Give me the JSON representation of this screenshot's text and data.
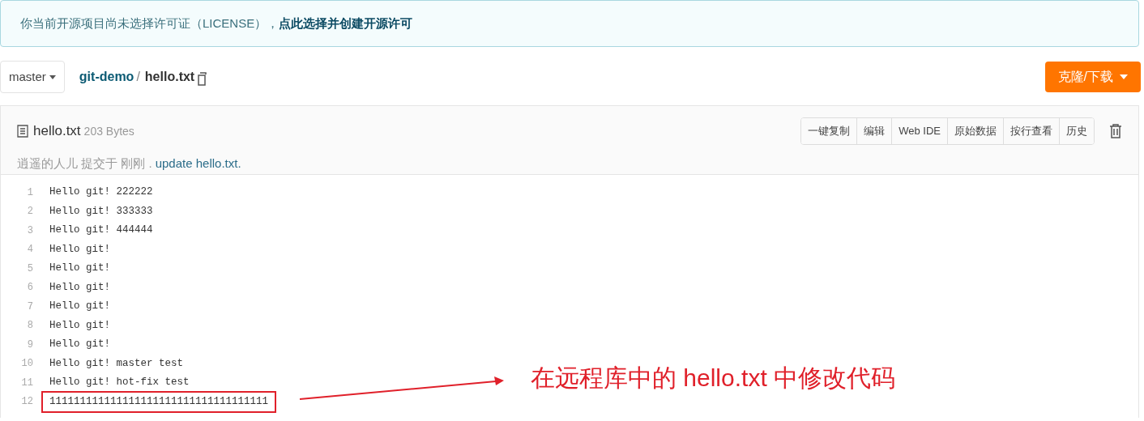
{
  "notice": {
    "text": "你当前开源项目尚未选择许可证（LICENSE），",
    "link": "点此选择并创建开源许可"
  },
  "branch": "master",
  "breadcrumb": {
    "repo": "git-demo",
    "separator": "/",
    "file": "hello.txt"
  },
  "clone_button": "克隆/下载",
  "file": {
    "name": "hello.txt",
    "size": "203 Bytes",
    "commit_author": "逍遥的人儿 提交于 刚刚 .",
    "commit_message": "update hello.txt."
  },
  "actions": [
    "一键复制",
    "编辑",
    "Web IDE",
    "原始数据",
    "按行查看",
    "历史"
  ],
  "lines": [
    {
      "number": "1",
      "code": "Hello git! 222222",
      "boxed": false
    },
    {
      "number": "2",
      "code": "Hello git! 333333",
      "boxed": false
    },
    {
      "number": "3",
      "code": "Hello git! 444444",
      "boxed": false
    },
    {
      "number": "4",
      "code": "Hello git!",
      "boxed": false
    },
    {
      "number": "5",
      "code": "Hello git!",
      "boxed": false
    },
    {
      "number": "6",
      "code": "Hello git!",
      "boxed": false
    },
    {
      "number": "7",
      "code": "Hello git!",
      "boxed": false
    },
    {
      "number": "8",
      "code": "Hello git!",
      "boxed": false
    },
    {
      "number": "9",
      "code": "Hello git!",
      "boxed": false
    },
    {
      "number": "10",
      "code": "Hello git! master test",
      "boxed": false
    },
    {
      "number": "11",
      "code": "Hello git! hot-fix test",
      "boxed": false
    },
    {
      "number": "12",
      "code": "111111111111111111111111111111111111",
      "boxed": true
    }
  ],
  "annotation": "在远程库中的 hello.txt 中修改代码"
}
